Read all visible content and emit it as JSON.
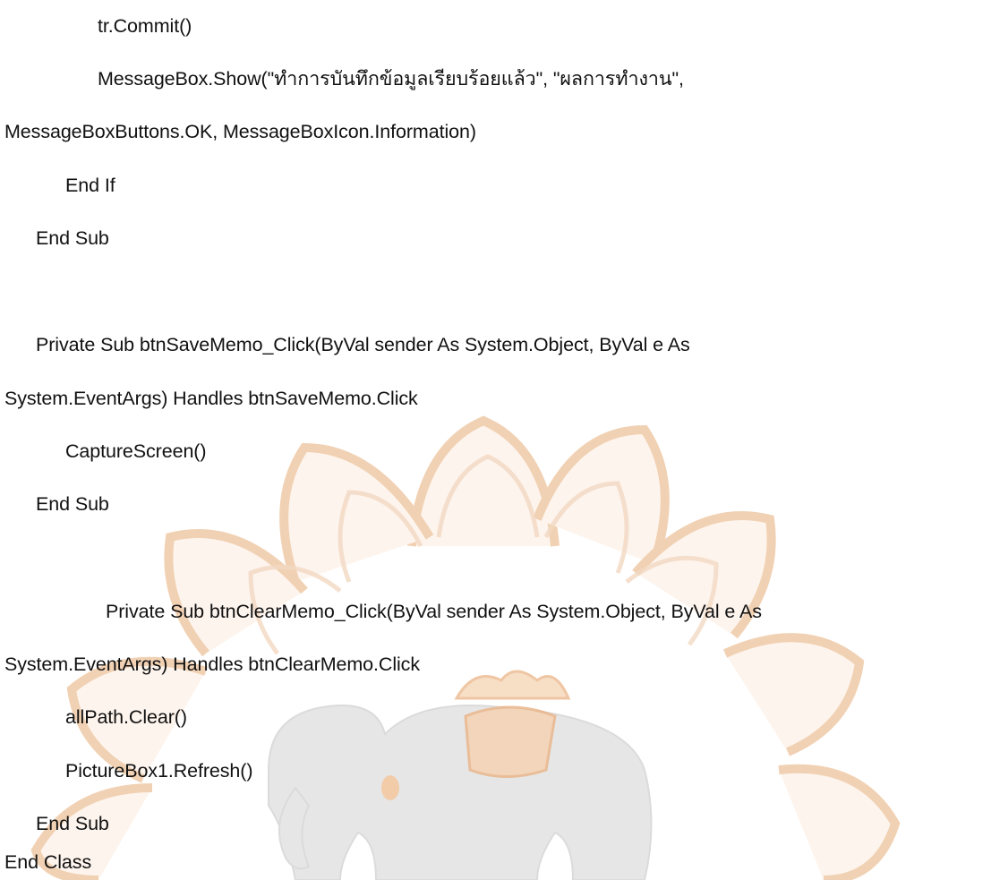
{
  "code_lines": [
    "tr.Commit()",
    "MessageBox.Show(\"ทำการบันทึกข้อมูลเรียบร้อยแล้ว\", \"ผลการทำงาน\",",
    "MessageBoxButtons.OK, MessageBoxIcon.Information)",
    "End If",
    "End Sub",
    "Private Sub btnSaveMemo_Click(ByVal sender As System.Object, ByVal e As",
    "System.EventArgs) Handles btnSaveMemo.Click",
    "CaptureScreen()",
    "End Sub",
    "Private Sub btnClearMemo_Click(ByVal sender As System.Object, ByVal e As",
    "System.EventArgs) Handles btnClearMemo.Click",
    "allPath.Clear()",
    "PictureBox1.Refresh()",
    "End Sub",
    "End Class"
  ],
  "colors": {
    "text": "#111111",
    "watermark_petal": "#f0c8a8",
    "watermark_petal_fill": "#fcefe4",
    "watermark_elephant": "#d8d8d8"
  },
  "watermark_icon": "university-emblem-lotus-elephant-icon"
}
